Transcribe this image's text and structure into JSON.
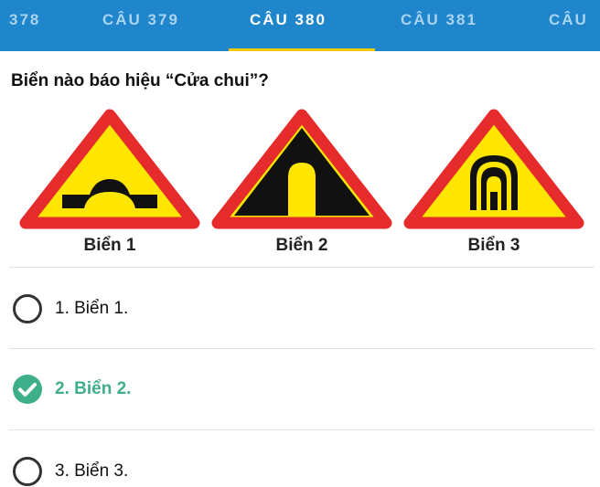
{
  "tabs": [
    {
      "label": "378"
    },
    {
      "label": "CÂU 379"
    },
    {
      "label": "CÂU 380"
    },
    {
      "label": "CÂU 381"
    },
    {
      "label": "CÂU"
    }
  ],
  "active_tab": "CÂU 380",
  "question": "Biển nào báo hiệu “Cửa chui”?",
  "signs": [
    {
      "label": "Biển 1",
      "icon": "bridge-hump-sign-icon"
    },
    {
      "label": "Biển 2",
      "icon": "underpass-door-sign-icon"
    },
    {
      "label": "Biển 3",
      "icon": "tunnel-sign-icon"
    }
  ],
  "options": [
    {
      "label": "1. Biển 1.",
      "checked": false
    },
    {
      "label": "2. Biển 2.",
      "checked": true
    },
    {
      "label": "3. Biển 3.",
      "checked": false
    }
  ],
  "colors": {
    "header": "#1f86cb",
    "indicator": "#f2c600",
    "correct": "#3fae8a",
    "sign_border": "#e52b2b",
    "sign_fill": "#ffe600"
  }
}
